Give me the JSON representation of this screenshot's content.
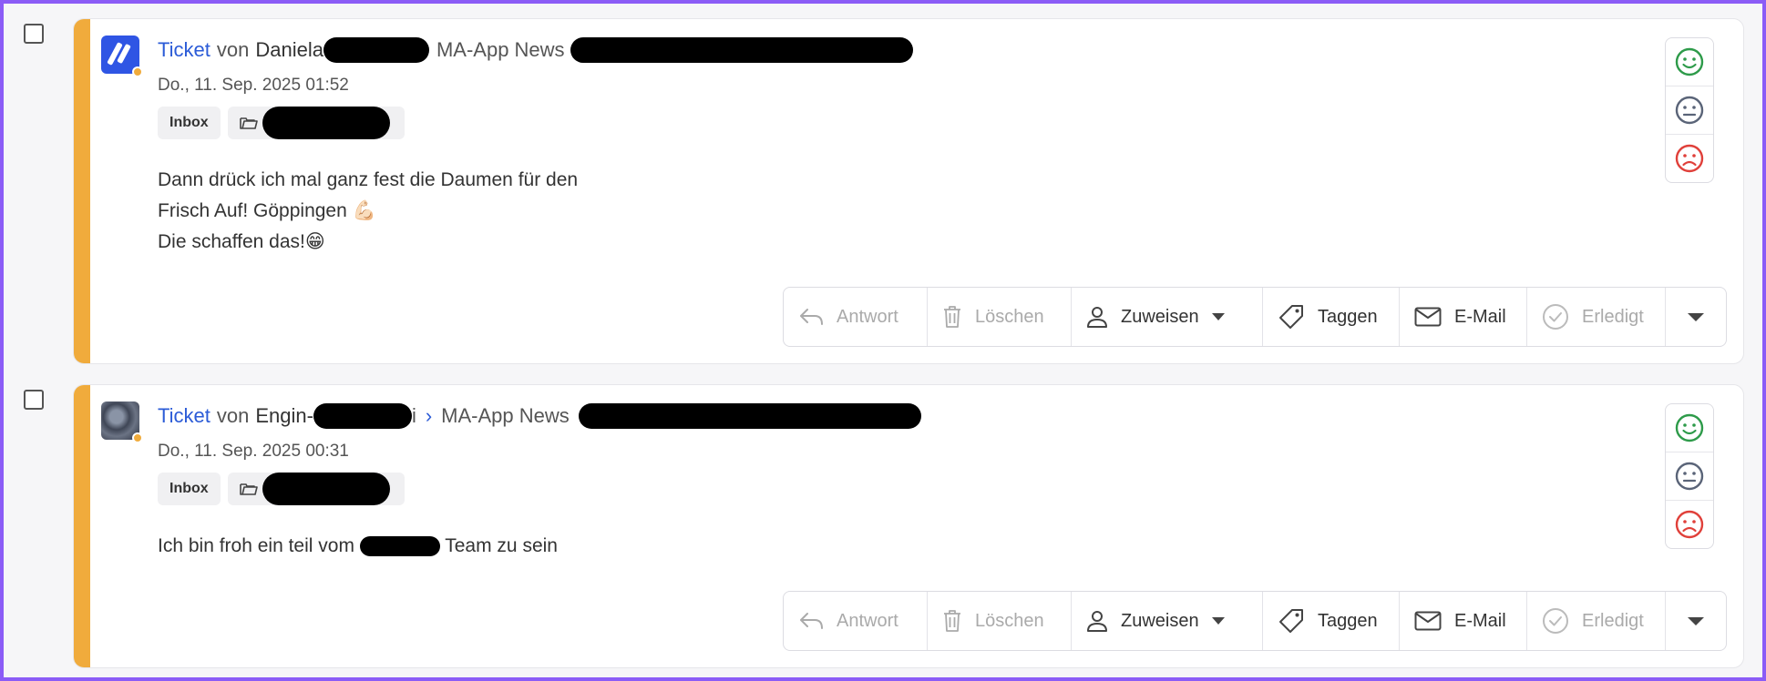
{
  "tickets": [
    {
      "type_label": "Ticket",
      "von": "von",
      "sender": "Daniela",
      "channel": "MA-App News",
      "date": "Do., 11. Sep. 2025 01:52",
      "tag_inbox": "Inbox",
      "message_lines": [
        "Dann drück ich mal ganz fest die Daumen für den",
        "Frisch Auf! Göppingen 💪🏻",
        "Die schaffen das!😁"
      ]
    },
    {
      "type_label": "Ticket",
      "von": "von",
      "sender": "Engin-",
      "sender_tail": "i",
      "channel": "MA-App News",
      "date": "Do., 11. Sep. 2025 00:31",
      "tag_inbox": "Inbox",
      "message_before": "Ich bin froh ein teil vom",
      "message_after": "Team zu sein"
    }
  ],
  "toolbar": {
    "reply": "Antwort",
    "delete": "Löschen",
    "assign": "Zuweisen",
    "tag": "Taggen",
    "email": "E-Mail",
    "done": "Erledigt"
  },
  "icons": {
    "reply": "reply-arrow-icon",
    "delete": "trash-icon",
    "assign": "user-icon",
    "tag": "tag-icon",
    "email": "envelope-icon",
    "done": "check-circle-icon",
    "more": "chevron-down-icon",
    "folder": "folder-icon",
    "happy": "smile-face-icon",
    "neutral": "neutral-face-icon",
    "sad": "sad-face-icon"
  },
  "colors": {
    "accent": "#f0ab3c",
    "link": "#2b5bd7",
    "frame": "#8b5cf6",
    "happy": "#2e9b4a",
    "neutral": "#5a6478",
    "sad": "#e0403a"
  }
}
